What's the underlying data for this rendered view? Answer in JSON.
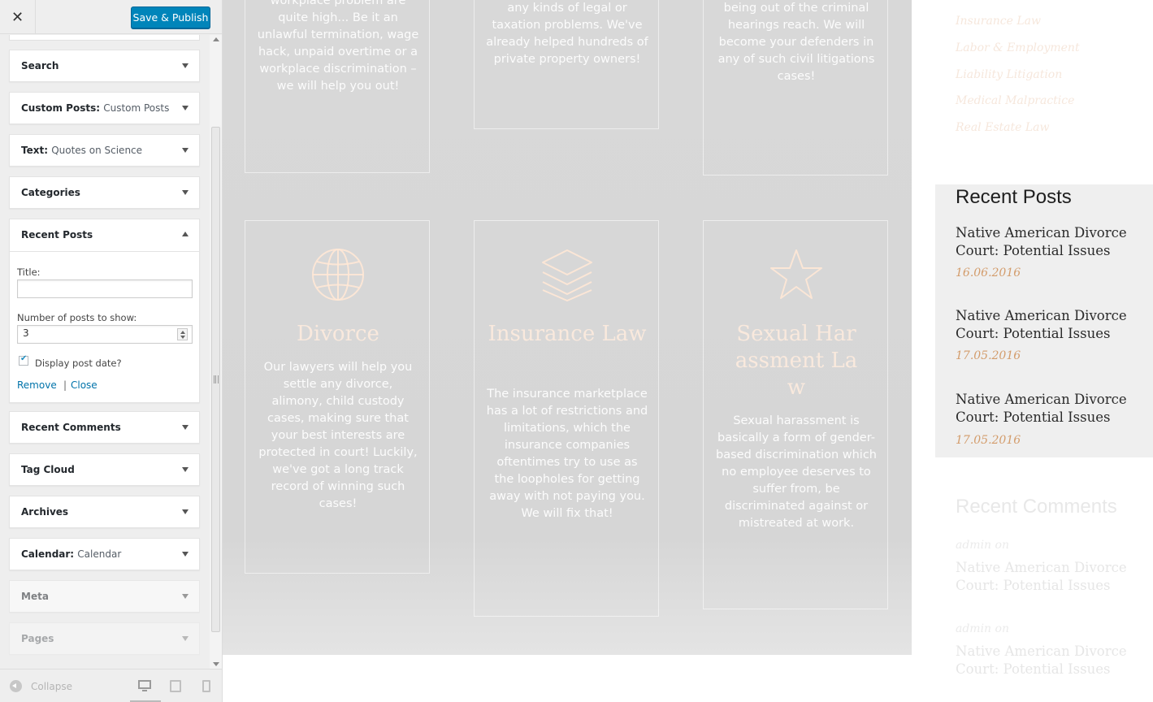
{
  "customizer": {
    "close_glyph": "✕",
    "save_label": "Save & Publish",
    "widgets": [
      {
        "title": "Search",
        "subtitle": ""
      },
      {
        "title": "Custom Posts:",
        "subtitle": "Custom Posts"
      },
      {
        "title": "Text:",
        "subtitle": "Quotes on Science"
      },
      {
        "title": "Categories",
        "subtitle": ""
      },
      {
        "title": "Recent Posts",
        "subtitle": ""
      },
      {
        "title": "Recent Comments",
        "subtitle": ""
      },
      {
        "title": "Tag Cloud",
        "subtitle": ""
      },
      {
        "title": "Archives",
        "subtitle": ""
      },
      {
        "title": "Calendar:",
        "subtitle": "Calendar"
      },
      {
        "title": "Meta",
        "subtitle": ""
      },
      {
        "title": "Pages",
        "subtitle": ""
      }
    ],
    "recent_posts_form": {
      "title_label": "Title:",
      "title_value": "",
      "number_label": "Number of posts to show:",
      "number_value": "3",
      "display_date_label": "Display post date?",
      "display_date_checked": true,
      "remove_label": "Remove",
      "separator": "|",
      "close_label": "Close"
    },
    "footer": {
      "collapse_label": "Collapse",
      "active_device": "desktop"
    },
    "colors": {
      "primary_button": "#0085ba",
      "link": "#0073aa"
    }
  },
  "preview": {
    "top_cards": [
      {
        "text": "workplace problem are quite high...  Be it an unlawful termination, wage hack, unpaid overtime or a workplace discrimination – we will help you out!"
      },
      {
        "text": "any kinds of legal or taxation problems. We've already helped hundreds of private property owners!"
      },
      {
        "text": "being out of the criminal hearings reach. We will become your defenders in any of such civil litigations cases!"
      }
    ],
    "cards": [
      {
        "icon": "globe-icon",
        "title": "Divorce",
        "text": "Our lawyers will help you settle any divorce, alimony, child custody cases, making sure that your best interests are protected in court! Luckily, we've got a long track record of winning such cases!"
      },
      {
        "icon": "layers-icon",
        "title": "Insurance Law",
        "text": "The insurance marketplace has a lot of restrictions and limitations, which the insurance companies oftentimes try to use as the loopholes for getting away with not paying you. We will fix that!"
      },
      {
        "icon": "star-icon",
        "title": "Sexual Harassment Law",
        "text": "Sexual harassment is basically a form of gender-based discrimination which no employee deserves to suffer from, be discriminated against or mistreated at work."
      }
    ],
    "sidebar": {
      "categories": [
        "Insurance Law",
        "Labor & Employment",
        "Liability Litigation",
        "Medical Malpractice",
        "Real Estate Law"
      ],
      "recent_posts_heading": "Recent Posts",
      "recent_posts": [
        {
          "title": "Native American Divorce Court: Potential Issues",
          "date": "16.06.2016"
        },
        {
          "title": "Native American Divorce Court: Potential Issues",
          "date": "17.05.2016"
        },
        {
          "title": "Native American Divorce Court: Potential Issues",
          "date": "17.05.2016"
        }
      ],
      "recent_comments_heading": "Recent Comments",
      "recent_comments": [
        {
          "author": "admin on",
          "title": "Native American Divorce Court: Potential Issues"
        },
        {
          "author": "admin on",
          "title": "Native American Divorce Court: Potential Issues"
        }
      ],
      "accent_color": "#d39c6b"
    }
  }
}
